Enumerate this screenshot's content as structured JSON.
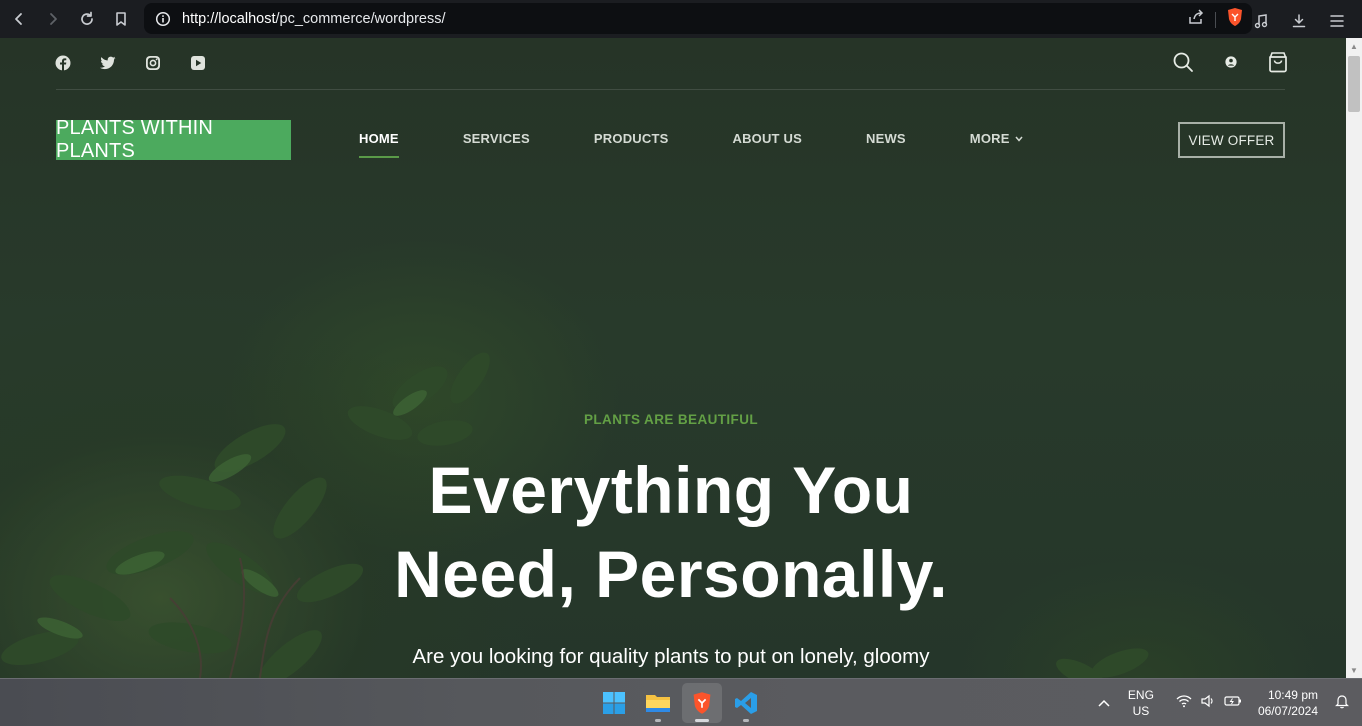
{
  "browser": {
    "url_host": "http://localhost",
    "url_path": "/pc_commerce/wordpress/",
    "icons": [
      "back-arrow-icon",
      "forward-arrow-icon",
      "reload-icon",
      "bookmark-icon",
      "info-icon",
      "share-icon",
      "brave-shield-icon",
      "media-icon",
      "download-icon",
      "menu-icon"
    ]
  },
  "header": {
    "social_icons": [
      "facebook-icon",
      "twitter-icon",
      "instagram-icon",
      "youtube-icon"
    ],
    "tool_icons": [
      "search-icon",
      "user-icon",
      "cart-icon"
    ],
    "logo": "PLANTS WITHIN PLANTS",
    "nav": [
      {
        "label": "HOME",
        "active": true
      },
      {
        "label": "SERVICES",
        "active": false
      },
      {
        "label": "PRODUCTS",
        "active": false
      },
      {
        "label": "ABOUT US",
        "active": false
      },
      {
        "label": "NEWS",
        "active": false
      },
      {
        "label": "MORE",
        "active": false
      }
    ],
    "cta": "VIEW OFFER"
  },
  "hero": {
    "eyebrow": "PLANTS ARE BEAUTIFUL",
    "title_line1": "Everything You",
    "title_line2": "Need, Personally.",
    "subtitle": "Are you looking for quality plants to put on lonely, gloomy"
  },
  "taskbar": {
    "apps": [
      "windows-start-icon",
      "file-explorer-icon",
      "brave-browser-icon",
      "vscode-icon"
    ],
    "language_line1": "ENG",
    "language_line2": "US",
    "time": "10:49 pm",
    "date": "06/07/2024"
  },
  "colors": {
    "accent_green": "#4caa5e",
    "eyebrow_green": "#63a045",
    "hero_bg": "#263427"
  }
}
